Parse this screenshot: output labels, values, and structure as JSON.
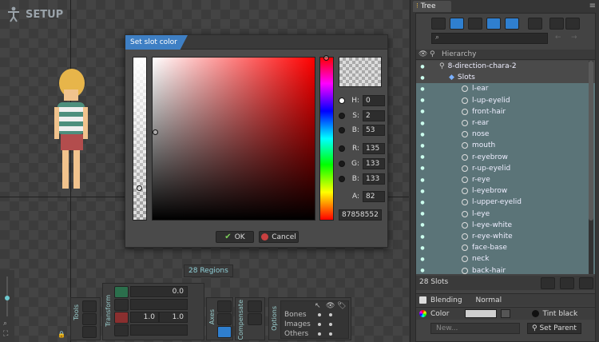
{
  "viewport": {
    "mode_title": "SETUP",
    "regions_label": "28 Regions"
  },
  "dialog": {
    "title": "Set slot color",
    "fields": [
      {
        "label": "H:",
        "value": "0",
        "selected": true
      },
      {
        "label": "S:",
        "value": "2",
        "selected": false
      },
      {
        "label": "B:",
        "value": "53",
        "selected": false
      },
      {
        "label": "R:",
        "value": "135",
        "selected": false
      },
      {
        "label": "G:",
        "value": "133",
        "selected": false
      },
      {
        "label": "B:",
        "value": "133",
        "selected": false
      }
    ],
    "alpha_label": "A:",
    "alpha_value": "82",
    "hex_value": "87858552",
    "ok_label": "OK",
    "cancel_label": "Cancel"
  },
  "toolbar": {
    "tools_label": "Tools",
    "transform_label": "Transform",
    "axes_label": "Axes",
    "compensate_label": "Compensate",
    "options_label": "Options",
    "rotate_value": "0.0",
    "scale_x": "1.0",
    "scale_y": "1.0",
    "options_rows": [
      "Bones",
      "Images",
      "Others"
    ]
  },
  "tree": {
    "tab_label": "Tree",
    "hierarchy_label": "Hierarchy",
    "skeleton_name": "8-direction-chara-2",
    "slots_folder": "Slots",
    "slots": [
      "l-ear",
      "l-up-eyelid",
      "front-hair",
      "r-ear",
      "nose",
      "mouth",
      "r-eyebrow",
      "r-up-eyelid",
      "r-eye",
      "l-eyebrow",
      "l-upper-eyelid",
      "l-eye",
      "l-eye-white",
      "r-eye-white",
      "face-base",
      "neck",
      "back-hair"
    ],
    "slots_count": "28 Slots",
    "blending_label": "Blending",
    "blending_value": "Normal",
    "color_label": "Color",
    "tint_label": "Tint black",
    "new_label": "New...",
    "set_parent_label": "Set Parent"
  },
  "colors": {
    "accent": "#3e7fc4",
    "selection": "#5b7478"
  }
}
